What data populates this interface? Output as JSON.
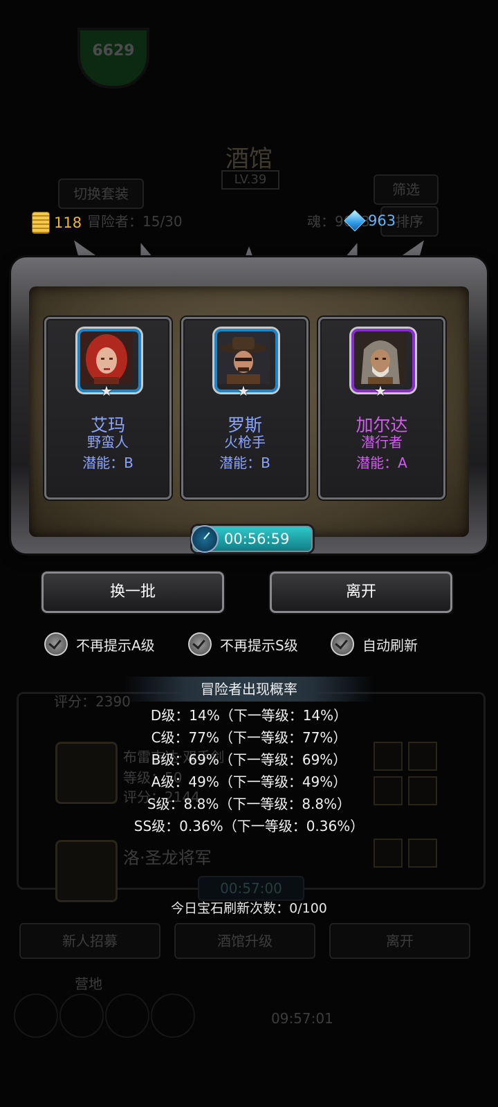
{
  "background": {
    "badge_text": "6629",
    "title": "酒馆",
    "level": "LV.39",
    "switch_outfit": "切换套装",
    "filter": "筛选",
    "adventurer_count": "冒险者：15/30",
    "soul": "魂：9093",
    "sort": "排序",
    "row1_score": "评分：2390",
    "row2_name": "布雷吉达·双手剑",
    "row2_level": "等级：50",
    "row2_score": "评分：2144",
    "row3_name": "洛·圣龙将军",
    "timer": "00:57:00",
    "btn_recruit": "新人招募",
    "btn_upgrade": "酒馆升级",
    "btn_leave": "离开",
    "bottom_label": "营地",
    "bottom_timer": "09:57:01"
  },
  "currency": {
    "gold": "118",
    "gems": "963"
  },
  "heroes": [
    {
      "name": "艾玛",
      "class": "野蛮人",
      "potential": "潜能：B",
      "rarity": "blue"
    },
    {
      "name": "罗斯",
      "class": "火枪手",
      "potential": "潜能：B",
      "rarity": "blue"
    },
    {
      "name": "加尔达",
      "class": "潜行者",
      "potential": "潜能：A",
      "rarity": "purple"
    }
  ],
  "timer": "00:56:59",
  "buttons": {
    "refresh": "换一批",
    "leave": "离开"
  },
  "options": [
    {
      "label": "不再提示A级",
      "checked": true
    },
    {
      "label": "不再提示S级",
      "checked": true
    },
    {
      "label": "自动刷新",
      "checked": true
    }
  ],
  "probability": {
    "title": "冒险者出现概率",
    "lines": [
      "D级：14%（下一等级：14%）",
      "C级：77%（下一等级：77%）",
      "B级：69%（下一等级：69%）",
      "A级：49%（下一等级：49%）",
      "S级：8.8%（下一等级：8.8%）",
      "SS级：0.36%（下一等级：0.36%）"
    ]
  },
  "gem_refresh": "今日宝石刷新次数：0/100"
}
